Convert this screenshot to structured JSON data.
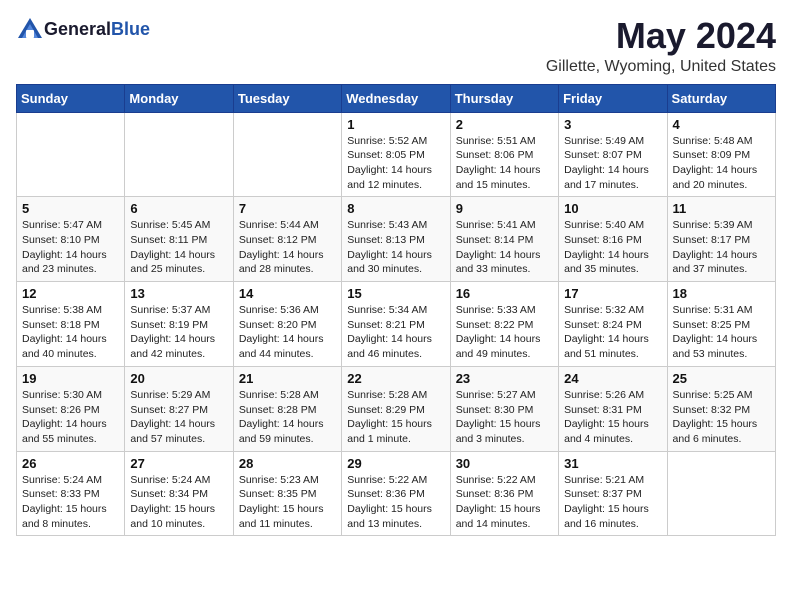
{
  "header": {
    "logo_general": "General",
    "logo_blue": "Blue",
    "title": "May 2024",
    "subtitle": "Gillette, Wyoming, United States"
  },
  "days_of_week": [
    "Sunday",
    "Monday",
    "Tuesday",
    "Wednesday",
    "Thursday",
    "Friday",
    "Saturday"
  ],
  "weeks": [
    {
      "days": [
        {
          "num": "",
          "info": ""
        },
        {
          "num": "",
          "info": ""
        },
        {
          "num": "",
          "info": ""
        },
        {
          "num": "1",
          "info": "Sunrise: 5:52 AM\nSunset: 8:05 PM\nDaylight: 14 hours\nand 12 minutes."
        },
        {
          "num": "2",
          "info": "Sunrise: 5:51 AM\nSunset: 8:06 PM\nDaylight: 14 hours\nand 15 minutes."
        },
        {
          "num": "3",
          "info": "Sunrise: 5:49 AM\nSunset: 8:07 PM\nDaylight: 14 hours\nand 17 minutes."
        },
        {
          "num": "4",
          "info": "Sunrise: 5:48 AM\nSunset: 8:09 PM\nDaylight: 14 hours\nand 20 minutes."
        }
      ]
    },
    {
      "days": [
        {
          "num": "5",
          "info": "Sunrise: 5:47 AM\nSunset: 8:10 PM\nDaylight: 14 hours\nand 23 minutes."
        },
        {
          "num": "6",
          "info": "Sunrise: 5:45 AM\nSunset: 8:11 PM\nDaylight: 14 hours\nand 25 minutes."
        },
        {
          "num": "7",
          "info": "Sunrise: 5:44 AM\nSunset: 8:12 PM\nDaylight: 14 hours\nand 28 minutes."
        },
        {
          "num": "8",
          "info": "Sunrise: 5:43 AM\nSunset: 8:13 PM\nDaylight: 14 hours\nand 30 minutes."
        },
        {
          "num": "9",
          "info": "Sunrise: 5:41 AM\nSunset: 8:14 PM\nDaylight: 14 hours\nand 33 minutes."
        },
        {
          "num": "10",
          "info": "Sunrise: 5:40 AM\nSunset: 8:16 PM\nDaylight: 14 hours\nand 35 minutes."
        },
        {
          "num": "11",
          "info": "Sunrise: 5:39 AM\nSunset: 8:17 PM\nDaylight: 14 hours\nand 37 minutes."
        }
      ]
    },
    {
      "days": [
        {
          "num": "12",
          "info": "Sunrise: 5:38 AM\nSunset: 8:18 PM\nDaylight: 14 hours\nand 40 minutes."
        },
        {
          "num": "13",
          "info": "Sunrise: 5:37 AM\nSunset: 8:19 PM\nDaylight: 14 hours\nand 42 minutes."
        },
        {
          "num": "14",
          "info": "Sunrise: 5:36 AM\nSunset: 8:20 PM\nDaylight: 14 hours\nand 44 minutes."
        },
        {
          "num": "15",
          "info": "Sunrise: 5:34 AM\nSunset: 8:21 PM\nDaylight: 14 hours\nand 46 minutes."
        },
        {
          "num": "16",
          "info": "Sunrise: 5:33 AM\nSunset: 8:22 PM\nDaylight: 14 hours\nand 49 minutes."
        },
        {
          "num": "17",
          "info": "Sunrise: 5:32 AM\nSunset: 8:24 PM\nDaylight: 14 hours\nand 51 minutes."
        },
        {
          "num": "18",
          "info": "Sunrise: 5:31 AM\nSunset: 8:25 PM\nDaylight: 14 hours\nand 53 minutes."
        }
      ]
    },
    {
      "days": [
        {
          "num": "19",
          "info": "Sunrise: 5:30 AM\nSunset: 8:26 PM\nDaylight: 14 hours\nand 55 minutes."
        },
        {
          "num": "20",
          "info": "Sunrise: 5:29 AM\nSunset: 8:27 PM\nDaylight: 14 hours\nand 57 minutes."
        },
        {
          "num": "21",
          "info": "Sunrise: 5:28 AM\nSunset: 8:28 PM\nDaylight: 14 hours\nand 59 minutes."
        },
        {
          "num": "22",
          "info": "Sunrise: 5:28 AM\nSunset: 8:29 PM\nDaylight: 15 hours\nand 1 minute."
        },
        {
          "num": "23",
          "info": "Sunrise: 5:27 AM\nSunset: 8:30 PM\nDaylight: 15 hours\nand 3 minutes."
        },
        {
          "num": "24",
          "info": "Sunrise: 5:26 AM\nSunset: 8:31 PM\nDaylight: 15 hours\nand 4 minutes."
        },
        {
          "num": "25",
          "info": "Sunrise: 5:25 AM\nSunset: 8:32 PM\nDaylight: 15 hours\nand 6 minutes."
        }
      ]
    },
    {
      "days": [
        {
          "num": "26",
          "info": "Sunrise: 5:24 AM\nSunset: 8:33 PM\nDaylight: 15 hours\nand 8 minutes."
        },
        {
          "num": "27",
          "info": "Sunrise: 5:24 AM\nSunset: 8:34 PM\nDaylight: 15 hours\nand 10 minutes."
        },
        {
          "num": "28",
          "info": "Sunrise: 5:23 AM\nSunset: 8:35 PM\nDaylight: 15 hours\nand 11 minutes."
        },
        {
          "num": "29",
          "info": "Sunrise: 5:22 AM\nSunset: 8:36 PM\nDaylight: 15 hours\nand 13 minutes."
        },
        {
          "num": "30",
          "info": "Sunrise: 5:22 AM\nSunset: 8:36 PM\nDaylight: 15 hours\nand 14 minutes."
        },
        {
          "num": "31",
          "info": "Sunrise: 5:21 AM\nSunset: 8:37 PM\nDaylight: 15 hours\nand 16 minutes."
        },
        {
          "num": "",
          "info": ""
        }
      ]
    }
  ]
}
